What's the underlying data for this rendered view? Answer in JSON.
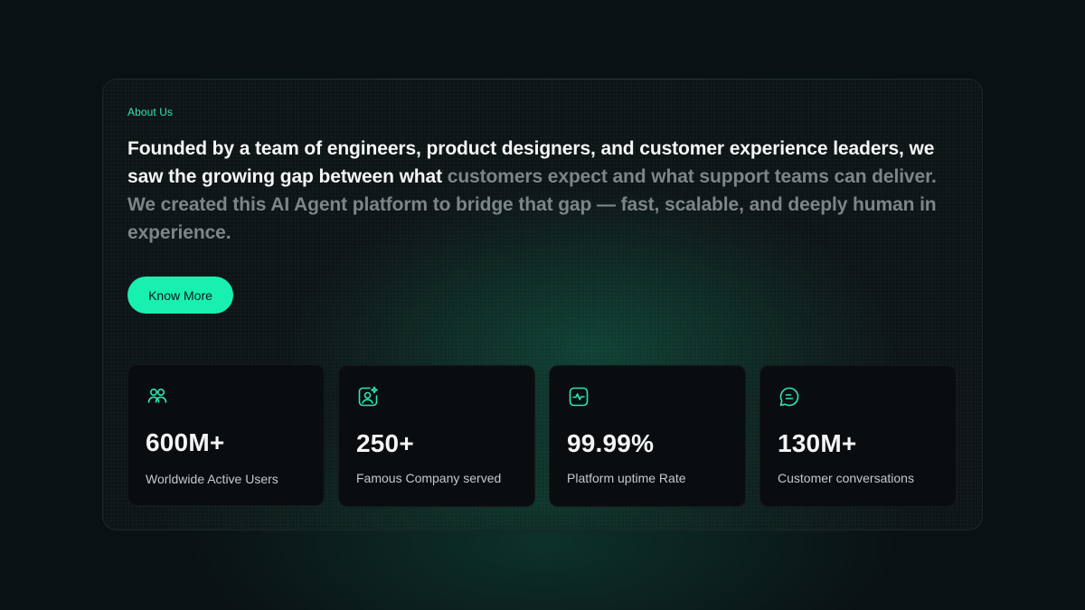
{
  "about": {
    "eyebrow": "About Us",
    "lead_highlight": "Founded by a team of engineers, product designers, and customer experience leaders, we saw the growing gap between what ",
    "lead_muted": "customers expect and what support teams can deliver. We created this AI Agent platform to bridge that gap — fast, scalable, and deeply human in experience.",
    "cta_label": "Know More"
  },
  "stats": [
    {
      "icon": "users-icon",
      "value": "600M+",
      "label": "Worldwide Active Users"
    },
    {
      "icon": "user-sparkle-icon",
      "value": "250+",
      "label": "Famous Company served"
    },
    {
      "icon": "activity-icon",
      "value": "99.99%",
      "label": "Platform uptime Rate"
    },
    {
      "icon": "chat-icon",
      "value": "130M+",
      "label": "Customer conversations"
    }
  ],
  "colors": {
    "accent": "#18f0b0",
    "background": "#0a1115",
    "card": "#0a0d10"
  }
}
